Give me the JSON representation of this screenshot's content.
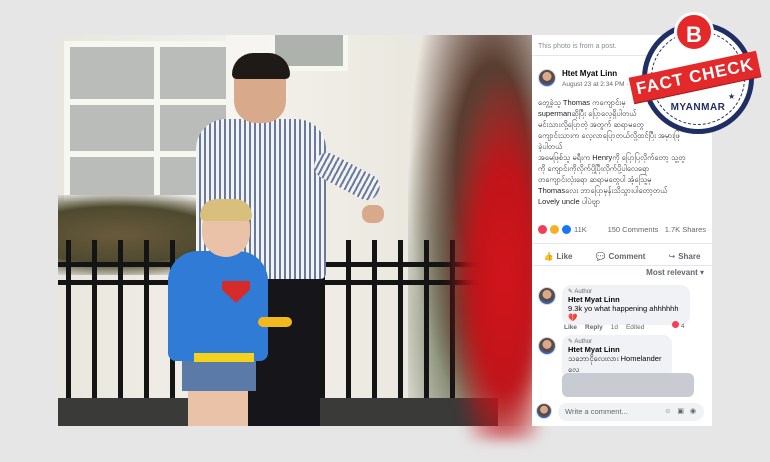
{
  "photo_panel": {
    "note": "This photo is from a post."
  },
  "post": {
    "author": "Htet Myat Linn",
    "date": "August 23 at 2:34 PM · ",
    "text_lines": [
      "တွေ့ခဲ့သူ Thomas ကကျောင်းမှ",
      "supermanဆိုပြီး ပြောလေ့ရှိပါတယ်",
      "မင်းသားလို့ပြောတဲ့ အတွက် ဆရာမတွေ",
      "ကျောင်းသားက လေ့လာပြောတယ်လို့ထင်ပြီး အမှားဖြ",
      "ခဲ့ပါတယ်",
      "အမေဖြစ်သူ မရီးက Henryကို ပြောပြလိုက်တော့ သူ့တူ",
      "ကို ကျောင်းကိုလိုက်ပို့ပြီးလိုက်ပို့ပါလေရော",
      "တကျောင်းလုံးရော ဆရာမတွေပါ အံ့သြေ့မှ",
      "Thomasလေး ဘာပြောမှန်းသိသွားပါတော့တယ်",
      "Lovely uncle ပါပဲဗျာ"
    ],
    "reaction_count": "11K",
    "comments_count": "150 Comments",
    "shares_count": "1.7K Shares",
    "actions": {
      "like": "Like",
      "comment": "Comment",
      "share": "Share"
    },
    "sort_label": "Most relevant",
    "reaction_colors": [
      "#f33e58",
      "#f7b125",
      "#1877f2"
    ]
  },
  "comments": [
    {
      "badge": "Author",
      "name": "Htet Myat Linn",
      "text": "9.3k yo what happening ahhhhhh💔",
      "like": "Like",
      "reply": "Reply",
      "age": "1d",
      "edited": "Edited",
      "reactions": "4"
    },
    {
      "badge": "Author",
      "name": "Htet Myat Linn",
      "text": "သဘောငိုလေးလား Homelander လေ"
    }
  ],
  "composer": {
    "placeholder": "Write a comment..."
  },
  "fact_check": {
    "logo_letter": "B",
    "label": "FACT CHECK",
    "country": "MYANMAR",
    "accent": "#e4292b",
    "navy": "#1f2f63"
  }
}
